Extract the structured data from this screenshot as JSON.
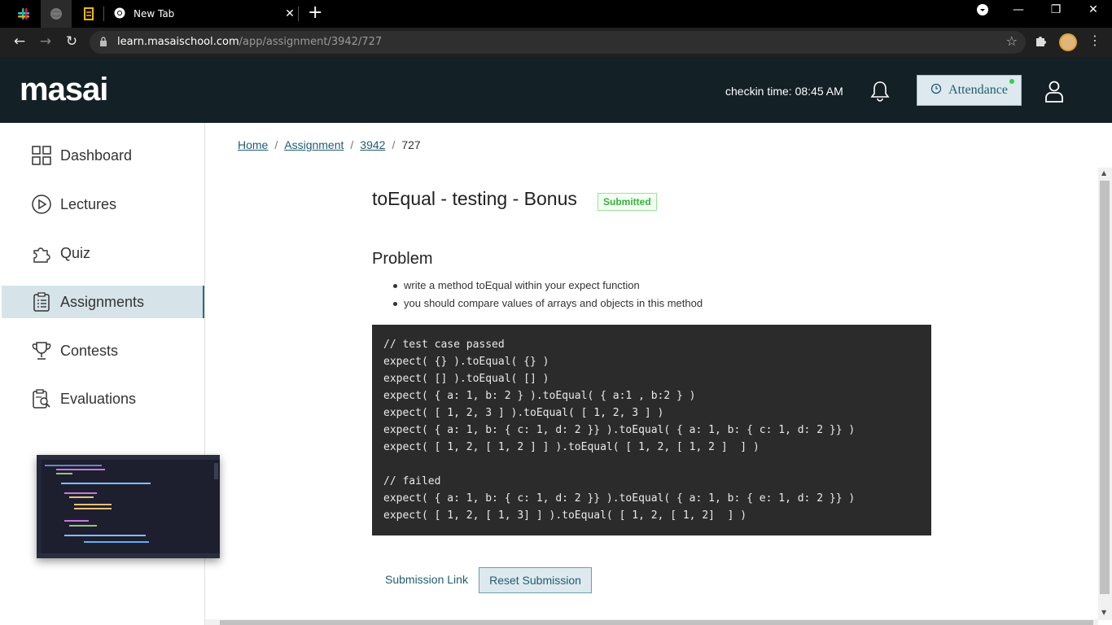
{
  "browser": {
    "tab_title": "New Tab",
    "url_host": "learn.masaischool.com",
    "url_path": "/app/assignment/3942/727"
  },
  "header": {
    "logo": "masai",
    "checkin": "checkin time: 08:45 AM",
    "attendance": "Attendance"
  },
  "sidebar": {
    "items": [
      {
        "label": "Dashboard",
        "icon": "grid-icon"
      },
      {
        "label": "Lectures",
        "icon": "play-circle-icon"
      },
      {
        "label": "Quiz",
        "icon": "puzzle-icon"
      },
      {
        "label": "Assignments",
        "icon": "clipboard-list-icon"
      },
      {
        "label": "Contests",
        "icon": "trophy-icon"
      },
      {
        "label": "Evaluations",
        "icon": "clipboard-search-icon"
      }
    ],
    "active_index": 3
  },
  "breadcrumb": {
    "home": "Home",
    "assignment": "Assignment",
    "id": "3942",
    "current": "727"
  },
  "main": {
    "title": "toEqual - testing - Bonus",
    "status": "Submitted",
    "problem_heading": "Problem",
    "bullets": [
      "write a method toEqual within your expect function",
      "you should compare values of arrays and objects in this method"
    ],
    "code_lines": [
      "// test case passed",
      "expect( {} ).toEqual( {} )",
      "expect( [] ).toEqual( [] )",
      "expect( { a: 1, b: 2 } ).toEqual( { a:1 , b:2 } )",
      "expect( [ 1, 2, 3 ] ).toEqual( [ 1, 2, 3 ] )",
      "expect( { a: 1, b: { c: 1, d: 2 }} ).toEqual( { a: 1, b: { c: 1, d: 2 }} )",
      "expect( [ 1, 2, [ 1, 2 ] ] ).toEqual( [ 1, 2, [ 1, 2 ]  ] )",
      "",
      "// failed",
      "expect( { a: 1, b: { c: 1, d: 2 }} ).toEqual( { a: 1, b: { e: 1, d: 2 }} )",
      "expect( [ 1, 2, [ 1, 3] ] ).toEqual( [ 1, 2, [ 1, 2]  ] )"
    ],
    "submission_link": "Submission Link",
    "reset_button": "Reset Submission"
  },
  "colors": {
    "header_bg": "#132026",
    "accent": "#1f5c73",
    "status_green": "#36b13c",
    "code_bg": "#2b2b2b"
  }
}
